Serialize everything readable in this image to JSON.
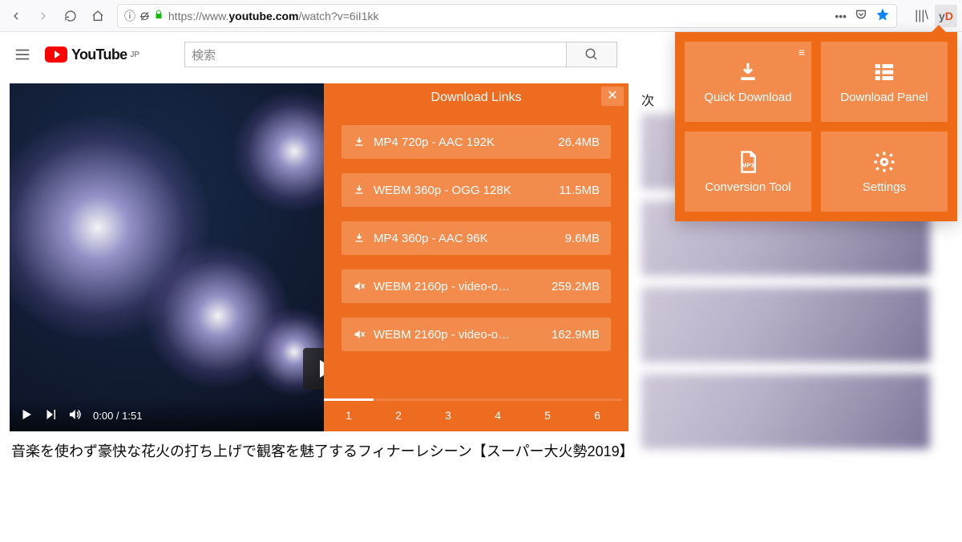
{
  "browser": {
    "url_scheme": "https://www.",
    "url_host": "youtube.com",
    "url_path": "/watch?v=6iI1kk",
    "ext_label_y": "y",
    "ext_label_d": "D"
  },
  "yt": {
    "logo_text": "YouTube",
    "logo_region": "JP",
    "search_placeholder": "検索"
  },
  "player": {
    "time": "0:00 / 1:51"
  },
  "dl_panel": {
    "title": "Download Links",
    "items": [
      {
        "icon": "download",
        "format": "MP4 720p - AAC 192K",
        "size": "26.4MB"
      },
      {
        "icon": "download",
        "format": "WEBM 360p - OGG 128K",
        "size": "11.5MB"
      },
      {
        "icon": "download",
        "format": "MP4 360p - AAC 96K",
        "size": "9.6MB"
      },
      {
        "icon": "mute",
        "format": "WEBM 2160p - video-o…",
        "size": "259.2MB"
      },
      {
        "icon": "mute",
        "format": "WEBM 2160p - video-o…",
        "size": "162.9MB"
      }
    ],
    "pages": [
      "1",
      "2",
      "3",
      "4",
      "5",
      "6"
    ]
  },
  "video": {
    "title": "音楽を使わず豪快な花火の打ち上げで観客を魅了するフィナーレシーン【スーパー大火勢2019】"
  },
  "sidebar": {
    "next_label": "次"
  },
  "ext_popup": {
    "tiles": [
      {
        "label": "Quick Download"
      },
      {
        "label": "Download Panel"
      },
      {
        "label": "Conversion Tool"
      },
      {
        "label": "Settings"
      }
    ]
  }
}
